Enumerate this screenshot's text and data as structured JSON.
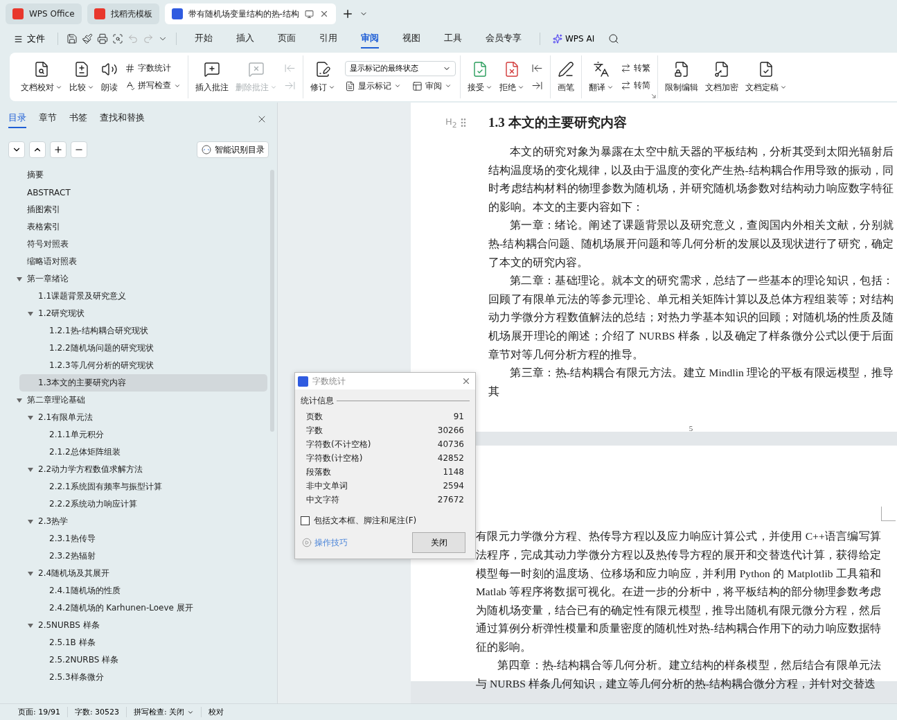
{
  "window_tabs": [
    {
      "label": "WPS Office",
      "selected": false
    },
    {
      "label": "找稻壳模板",
      "selected": false
    },
    {
      "label": "带有随机场变量结构的热-结构",
      "selected": true
    }
  ],
  "menu": {
    "file": "文件",
    "tabs": [
      {
        "label": "开始",
        "selected": false
      },
      {
        "label": "插入",
        "selected": false
      },
      {
        "label": "页面",
        "selected": false
      },
      {
        "label": "引用",
        "selected": false
      },
      {
        "label": "审阅",
        "selected": true
      },
      {
        "label": "视图",
        "selected": false
      },
      {
        "label": "工具",
        "selected": false
      },
      {
        "label": "会员专享",
        "selected": false
      }
    ],
    "ai": "WPS AI"
  },
  "ribbon": [
    {
      "items": [
        {
          "kind": "large",
          "label": "文档校对",
          "dropdown": true,
          "disabled": false
        },
        {
          "kind": "large",
          "label": "比较",
          "dropdown": true,
          "disabled": false
        },
        {
          "kind": "large",
          "label": "朗读",
          "dropdown": false,
          "disabled": false
        },
        {
          "kind": "stack",
          "rows": [
            {
              "kind": "small",
              "label": "字数统计",
              "dropdown": false,
              "disabled": false
            },
            {
              "kind": "small",
              "label": "拼写检查",
              "dropdown": true,
              "disabled": false
            }
          ]
        }
      ]
    },
    {
      "items": [
        {
          "kind": "large",
          "label": "插入批注",
          "dropdown": false,
          "disabled": false
        },
        {
          "kind": "large",
          "label": "删除批注",
          "dropdown": true,
          "disabled": true
        },
        {
          "kind": "stack",
          "rows": [
            {
              "kind": "icon",
              "disabled": true
            },
            {
              "kind": "icon",
              "disabled": true
            }
          ]
        }
      ]
    },
    {
      "items": [
        {
          "kind": "large",
          "label": "修订",
          "dropdown": true,
          "disabled": false
        },
        {
          "kind": "stack",
          "rows": [
            {
              "kind": "select",
              "value": "显示标记的最终状态"
            },
            {
              "kind": "pair",
              "items": [
                {
                  "label": "显示标记",
                  "dropdown": true,
                  "disabled": false
                },
                {
                  "label": "审阅",
                  "dropdown": true,
                  "disabled": false
                }
              ]
            }
          ]
        }
      ]
    },
    {
      "items": [
        {
          "kind": "large",
          "label": "接受",
          "dropdown": true,
          "disabled": false
        },
        {
          "kind": "large",
          "label": "拒绝",
          "dropdown": true,
          "disabled": false
        },
        {
          "kind": "stack",
          "rows": [
            {
              "kind": "icon",
              "disabled": false
            },
            {
              "kind": "icon",
              "disabled": false
            }
          ]
        }
      ]
    },
    {
      "items": [
        {
          "kind": "large",
          "label": "画笔",
          "dropdown": false,
          "disabled": false
        }
      ]
    },
    {
      "launcher": true,
      "items": [
        {
          "kind": "large",
          "label": "翻译",
          "dropdown": true,
          "disabled": false
        },
        {
          "kind": "stack",
          "rows": [
            {
              "kind": "small",
              "label": "转繁",
              "dropdown": false,
              "disabled": false
            },
            {
              "kind": "small",
              "label": "转简",
              "dropdown": false,
              "disabled": false
            }
          ]
        }
      ]
    },
    {
      "items": [
        {
          "kind": "large",
          "label": "限制编辑",
          "dropdown": false,
          "disabled": false
        },
        {
          "kind": "large",
          "label": "文档加密",
          "dropdown": false,
          "disabled": false
        },
        {
          "kind": "large",
          "label": "文档定稿",
          "dropdown": true,
          "disabled": false
        }
      ]
    }
  ],
  "nav_panel": {
    "tabs": [
      {
        "label": "目录",
        "selected": true
      },
      {
        "label": "章节",
        "selected": false
      },
      {
        "label": "书签",
        "selected": false
      },
      {
        "label": "查找和替换",
        "selected": false
      }
    ],
    "smart_button": "智能识别目录",
    "tree": [
      {
        "label": "摘要",
        "selected": false
      },
      {
        "label": "ABSTRACT",
        "selected": false
      },
      {
        "label": "插图索引",
        "selected": false
      },
      {
        "label": "表格索引",
        "selected": false
      },
      {
        "label": "符号对照表",
        "selected": false
      },
      {
        "label": "缩略语对照表",
        "selected": false
      },
      {
        "label": "第一章绪论",
        "selected": false,
        "expanded": true,
        "children": [
          {
            "label": "1.1课题背景及研究意义",
            "selected": false
          },
          {
            "label": "1.2研究现状",
            "selected": false,
            "expanded": true,
            "children": [
              {
                "label": "1.2.1热-结构耦合研究现状",
                "selected": false
              },
              {
                "label": "1.2.2随机场问题的研究现状",
                "selected": false
              },
              {
                "label": "1.2.3等几何分析的研究现状",
                "selected": false
              }
            ]
          },
          {
            "label": "1.3本文的主要研究内容",
            "selected": true
          }
        ]
      },
      {
        "label": "第二章理论基础",
        "selected": false,
        "expanded": true,
        "children": [
          {
            "label": "2.1有限单元法",
            "selected": false,
            "expanded": true,
            "children": [
              {
                "label": "2.1.1单元积分",
                "selected": false
              },
              {
                "label": "2.1.2总体矩阵组装",
                "selected": false
              }
            ]
          },
          {
            "label": "2.2动力学方程数值求解方法",
            "selected": false,
            "expanded": true,
            "children": [
              {
                "label": "2.2.1系统固有频率与振型计算",
                "selected": false
              },
              {
                "label": "2.2.2系统动力响应计算",
                "selected": false
              }
            ]
          },
          {
            "label": "2.3热学",
            "selected": false,
            "expanded": true,
            "children": [
              {
                "label": "2.3.1热传导",
                "selected": false
              },
              {
                "label": "2.3.2热辐射",
                "selected": false
              }
            ]
          },
          {
            "label": "2.4随机场及其展开",
            "selected": false,
            "expanded": true,
            "children": [
              {
                "label": "2.4.1随机场的性质",
                "selected": false
              },
              {
                "label": "2.4.2随机场的 Karhunen-Loeve 展开",
                "selected": false
              }
            ]
          },
          {
            "label": "2.5NURBS 样条",
            "selected": false,
            "expanded": true,
            "children": [
              {
                "label": "2.5.1B 样条",
                "selected": false
              },
              {
                "label": "2.5.2NURBS 样条",
                "selected": false
              },
              {
                "label": "2.5.3样条微分",
                "selected": false
              }
            ]
          }
        ]
      }
    ]
  },
  "document": {
    "heading_marker": "H$_{2}$",
    "heading": "1.3 本文的主要研究内容",
    "page1_paragraphs": [
      {
        "indent": true,
        "text": "本文的研究对象为暴露在太空中航天器的平板结构，分析其受到太阳光辐射后结构温度场的变化规律，以及由于温度的变化产生热-结构耦合作用导致的振动，同时考虑结构材料的物理参数为随机场，并研究随机场参数对结构动力响应数字特征的影响。本文的主要内容如下："
      },
      {
        "indent": true,
        "text": "第一章：绪论。阐述了课题背景以及研究意义，查阅国内外相关文献，分别就热-结构耦合问题、随机场展开问题和等几何分析的发展以及现状进行了研究，确定了本文的研究内容。"
      },
      {
        "indent": true,
        "text": "第二章：基础理论。就本文的研究需求，总结了一些基本的理论知识，包括：回顾了有限单元法的等参元理论、单元相关矩阵计算以及总体方程组装等；对结构动力学微分方程数值解法的总结；对热力学基本知识的回顾；对随机场的性质及随机场展开理论的阐述；介绍了 NURBS 样条，以及确定了样条微分公式以便于后面章节对等几何分析方程的推导。"
      },
      {
        "indent": true,
        "text": "第三章：热-结构耦合有限元方法。建立 Mindlin 理论的平板有限远模型，推导其"
      }
    ],
    "page_number": "5",
    "page2_paragraphs": [
      {
        "indent": false,
        "text": "有限元力学微分方程、热传导方程以及应力响应计算公式，并使用 C++语言编写算法程序，完成其动力学微分方程以及热传导方程的展开和交替迭代计算，获得给定模型每一时刻的温度场、位移场和应力响应，并利用 Python 的 Matplotlib 工具箱和 Matlab 等程序将数据可视化。在进一步的分析中，将平板结构的部分物理参数考虑为随机场变量，结合已有的确定性有限元模型，推导出随机有限元微分方程，然后通过算例分析弹性模量和质量密度的随机性对热-结构耦合作用下的动力响应数据特征的影响。"
      },
      {
        "indent": true,
        "text": "第四章：热-结构耦合等几何分析。建立结构的样条模型，然后结合有限单元法与 NURBS 样条几何知识，建立等几何分析的热-结构耦合微分方程，并针对交替迭"
      }
    ]
  },
  "word_count_dialog": {
    "title": "字数统计",
    "section": "统计信息",
    "rows": [
      {
        "label": "页数",
        "value": "91"
      },
      {
        "label": "字数",
        "value": "30266"
      },
      {
        "label": "字符数(不计空格)",
        "value": "40736"
      },
      {
        "label": "字符数(计空格)",
        "value": "42852"
      },
      {
        "label": "段落数",
        "value": "1148"
      },
      {
        "label": "非中文单词",
        "value": "2594"
      },
      {
        "label": "中文字符",
        "value": "27672"
      }
    ],
    "checkbox": {
      "label": "包括文本框、脚注和尾注(F)",
      "checked": false
    },
    "tips_link": "操作技巧",
    "close_button": "关闭"
  },
  "status_bar": [
    {
      "label": "页面: 19/91",
      "dropdown": false
    },
    {
      "label": "字数: 30523",
      "dropdown": false
    },
    {
      "label": "拼写检查: 关闭",
      "dropdown": true
    },
    {
      "label": "校对",
      "dropdown": false
    }
  ]
}
